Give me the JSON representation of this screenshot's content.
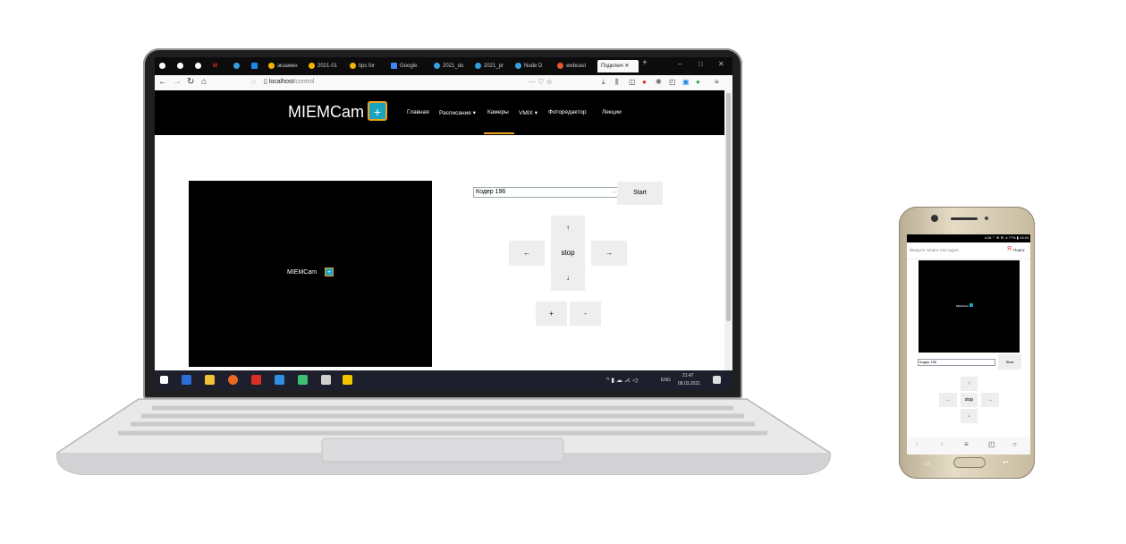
{
  "browser": {
    "tabs": [
      {
        "label": "",
        "color": "#ffffff"
      },
      {
        "label": "",
        "color": "#ffffff"
      },
      {
        "label": "",
        "color": "#ffffff"
      },
      {
        "label": "M",
        "color": "#d93025"
      },
      {
        "label": "",
        "color": "#35a0e0"
      },
      {
        "label": "",
        "color": "#1e88e5"
      },
      {
        "label": "экзамен",
        "color": "#f4b400"
      },
      {
        "label": "2021-01",
        "color": "#f4b400"
      },
      {
        "label": "tips for ",
        "color": "#f4b400"
      },
      {
        "label": "Google",
        "color": "#4285f4"
      },
      {
        "label": "2021_do",
        "color": "#35a0e0"
      },
      {
        "label": "2021_pr",
        "color": "#35a0e0"
      },
      {
        "label": "Nude D",
        "color": "#35a0e0"
      },
      {
        "label": "webcast",
        "color": "#e8572f"
      }
    ],
    "active_tab": "Подключ",
    "new_tab": "+",
    "window_controls": [
      "–",
      "□",
      "✕"
    ],
    "url_host": "localhost",
    "url_path": "/control",
    "url_actions": "··· ♡ ☆"
  },
  "site": {
    "brand": "MIEMCam",
    "brand_icon": "+",
    "menu": [
      "Главная",
      "Расписание ▾",
      "Камеры",
      "VMIX ▾",
      "Фоторедактор",
      "Лекции"
    ],
    "active_menu": "Камеры"
  },
  "control": {
    "video_label": "MIEMCam",
    "select_value": "Кодер 196",
    "start_label": "Start",
    "up": "↑",
    "left": "←",
    "stop": "stop",
    "right": "→",
    "down": "↓",
    "zoom_in": "+",
    "zoom_out": "-"
  },
  "taskbar": {
    "lang": "ENG",
    "time": "21:47",
    "date": "08.03.2021"
  },
  "phone": {
    "status_text": "4:18 ♡ ⊕ ⚙ .ıl 77% ▮ 13:43",
    "address_placeholder": "Введите запрос или адрес",
    "search_label": "Поиск",
    "video_label": "MIEMCam",
    "select_value": "Кодер 196",
    "start_label": "Start",
    "up": "↑",
    "left": "←",
    "stop": "stop",
    "right": "→",
    "down": "↓"
  }
}
